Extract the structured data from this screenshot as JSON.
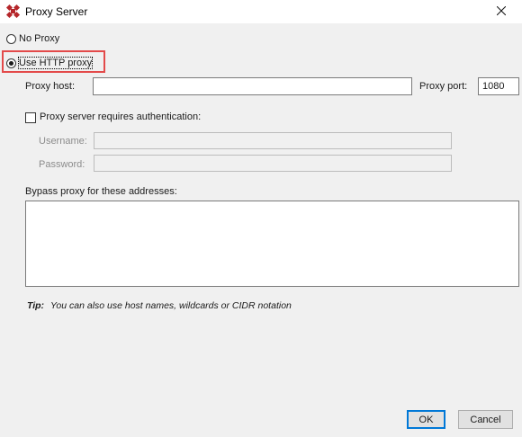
{
  "window": {
    "title": "Proxy Server",
    "close_icon": "close-icon"
  },
  "proxy_mode": {
    "no_proxy_label": "No Proxy",
    "use_http_label": "Use HTTP proxy",
    "selected": "use_http"
  },
  "host": {
    "label": "Proxy host:",
    "value": ""
  },
  "port": {
    "label": "Proxy port:",
    "value": "1080"
  },
  "auth": {
    "checkbox_label": "Proxy server requires authentication:",
    "checked": false,
    "username_label": "Username:",
    "username_value": "",
    "password_label": "Password:",
    "password_value": ""
  },
  "bypass": {
    "label": "Bypass proxy for these addresses:",
    "value": ""
  },
  "tip": {
    "prefix": "Tip:",
    "text": "You can also use host names, wildcards or CIDR notation"
  },
  "buttons": {
    "ok": "OK",
    "cancel": "Cancel"
  },
  "colors": {
    "highlight": "#e34a4a",
    "default_button_border": "#0078d7",
    "app_icon": "#b5262a"
  }
}
